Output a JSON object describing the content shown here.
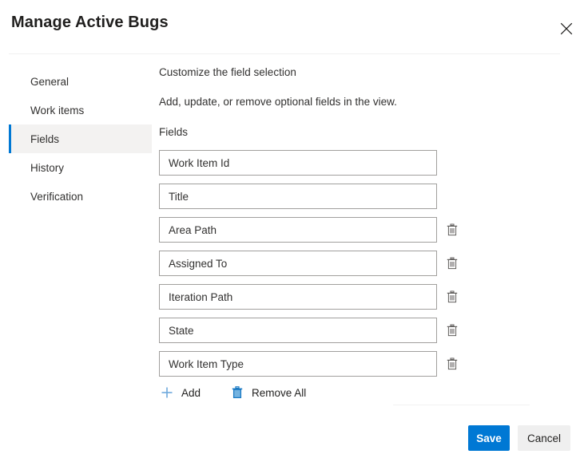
{
  "dialog": {
    "title": "Manage Active Bugs",
    "close_icon": "close-icon",
    "close_label": "Close"
  },
  "sidebar": {
    "items": [
      {
        "label": "General",
        "selected": false
      },
      {
        "label": "Work items",
        "selected": false
      },
      {
        "label": "Fields",
        "selected": true
      },
      {
        "label": "History",
        "selected": false
      },
      {
        "label": "Verification",
        "selected": false
      }
    ],
    "selected_indicator_color": "#0078d4",
    "selected_background": "#f3f2f1"
  },
  "content": {
    "heading": "Customize the field selection",
    "description": "Add, update, or remove optional fields in the view.",
    "fields_label": "Fields",
    "fields": [
      {
        "value": "Work Item Id",
        "deletable": false,
        "delete_icon": "trash-icon"
      },
      {
        "value": "Title",
        "deletable": false,
        "delete_icon": "trash-icon"
      },
      {
        "value": "Area Path",
        "deletable": true,
        "delete_icon": "trash-icon"
      },
      {
        "value": "Assigned To",
        "deletable": true,
        "delete_icon": "trash-icon"
      },
      {
        "value": "Iteration Path",
        "deletable": true,
        "delete_icon": "trash-icon"
      },
      {
        "value": "State",
        "deletable": true,
        "delete_icon": "trash-icon"
      },
      {
        "value": "Work Item Type",
        "deletable": true,
        "delete_icon": "trash-icon"
      }
    ],
    "actions": {
      "add_label": "Add",
      "add_icon": "plus-icon",
      "remove_all_label": "Remove All",
      "remove_all_icon": "trash-icon"
    }
  },
  "footer": {
    "save_label": "Save",
    "cancel_label": "Cancel",
    "primary_color": "#0078d4",
    "secondary_color": "#efefef"
  }
}
